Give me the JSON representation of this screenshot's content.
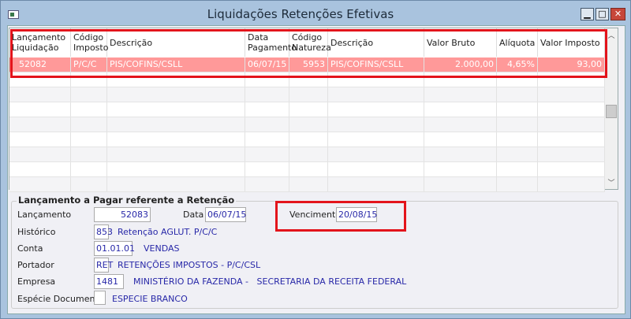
{
  "window": {
    "title": "Liquidações Retenções Efetivas",
    "minimize": "▁",
    "maximize": "□",
    "close": "✕"
  },
  "grid": {
    "columns": [
      "Lançamento Liquidação",
      "Código Imposto",
      "Descrição",
      "Data Pagamento",
      "Código Natureza",
      "Descrição",
      "Valor Bruto",
      "Alíquota",
      "Valor Imposto"
    ],
    "rows": [
      [
        "52082",
        "P/C/C",
        "PIS/COFINS/CSLL",
        "06/07/15",
        "5953",
        "PIS/COFINS/CSLL",
        "2.000,00",
        "4,65%",
        "93,00"
      ]
    ]
  },
  "form": {
    "group_title": "Lançamento a Pagar referente a Retenção",
    "lancamento_label": "Lançamento",
    "lancamento": "52083",
    "data_label": "Data",
    "data": "06/07/15",
    "vencimento_label": "Vencimento",
    "vencimento": "20/08/15",
    "historico_label": "Histórico",
    "historico_code": "853",
    "historico_desc": "Retenção AGLUT. P/C/C",
    "conta_label": "Conta",
    "conta_code": "01.01.01",
    "conta_desc": "VENDAS",
    "portador_label": "Portador",
    "portador_code": "RET",
    "portador_desc": "RETENÇÕES IMPOSTOS - P/C/CSL",
    "empresa_label": "Empresa",
    "empresa_code": "1481",
    "empresa_desc": "MINISTÉRIO DA FAZENDA -   SECRETARIA DA RECEITA FEDERAL",
    "especie_label": "Espécie Documento",
    "especie_code": "",
    "especie_desc": "ESPECIE BRANCO"
  },
  "colors": {
    "selected_row": "#ff9999",
    "highlight": "#e3141b",
    "value_text": "#2828a8"
  }
}
